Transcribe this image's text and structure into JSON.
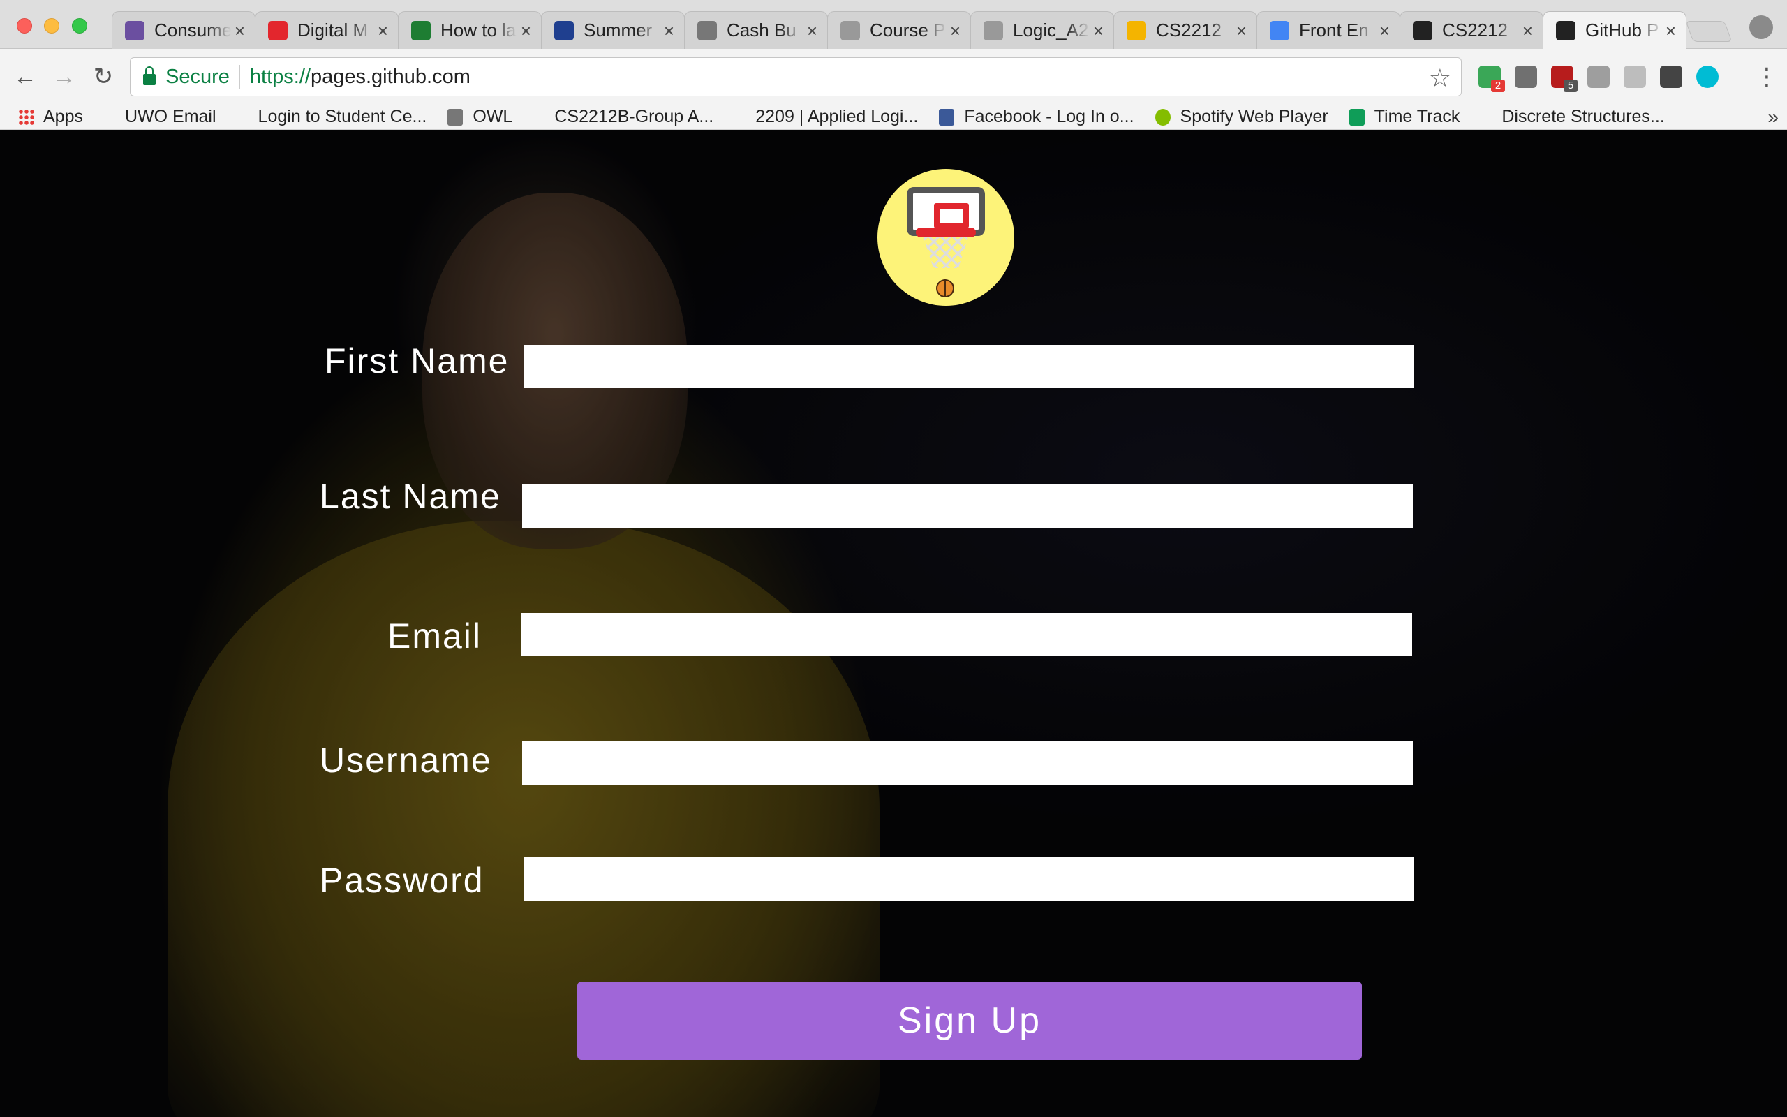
{
  "browser": {
    "tabs": [
      {
        "label": "Consumer",
        "favicon": "shield-icon",
        "color": "#6b4fa0",
        "active": false
      },
      {
        "label": "Digital M",
        "favicon": "red-circle-icon",
        "color": "#e3262d",
        "active": false
      },
      {
        "label": "How to la",
        "favicon": "green-a-icon",
        "color": "#1e7d32",
        "active": false
      },
      {
        "label": "Summer",
        "favicon": "blue-crest-icon",
        "color": "#1f3f8f",
        "active": false
      },
      {
        "label": "Cash Bu",
        "favicon": "mascot-icon",
        "color": "#777777",
        "active": false
      },
      {
        "label": "Course P",
        "favicon": "page-icon",
        "color": "#999999",
        "active": false
      },
      {
        "label": "Logic_A2",
        "favicon": "page-icon",
        "color": "#999999",
        "active": false
      },
      {
        "label": "CS2212",
        "favicon": "google-drive-icon",
        "color": "#f4b400",
        "active": false
      },
      {
        "label": "Front En",
        "favicon": "google-docs-icon",
        "color": "#4285f4",
        "active": false
      },
      {
        "label": "CS2212",
        "favicon": "github-icon",
        "color": "#222222",
        "active": false
      },
      {
        "label": "GitHub P",
        "favicon": "github-icon",
        "color": "#222222",
        "active": true
      }
    ],
    "close_glyph": "×",
    "security_label": "Secure",
    "url_scheme": "https://",
    "url_host": "pages.github.com",
    "extensions": [
      {
        "name": "green-extension-icon",
        "color": "#3aa757",
        "badge": "2",
        "badge_color": "#e53935"
      },
      {
        "name": "google-drive-extension-icon",
        "color": "#707070",
        "badge": "",
        "badge_color": ""
      },
      {
        "name": "ublock-icon",
        "color": "#b71c1c",
        "badge": "5",
        "badge_color": "#555555"
      },
      {
        "name": "power-icon",
        "color": "#9e9e9e",
        "badge": "",
        "badge_color": ""
      },
      {
        "name": "recycle-icon",
        "color": "#bdbdbd",
        "badge": "",
        "badge_color": ""
      },
      {
        "name": "color-wheel-icon",
        "color": "#444444",
        "badge": "",
        "badge_color": ""
      },
      {
        "name": "m-avatar-icon",
        "color": "#00bcd4",
        "badge": "",
        "badge_color": ""
      }
    ],
    "bookmarks": [
      {
        "label": "Apps",
        "icon": "apps-grid-icon"
      },
      {
        "label": "UWO Email",
        "icon": "page-icon"
      },
      {
        "label": "Login to Student Ce...",
        "icon": "page-icon"
      },
      {
        "label": "OWL",
        "icon": "owl-icon"
      },
      {
        "label": "CS2212B-Group A...",
        "icon": "page-icon"
      },
      {
        "label": "2209 | Applied Logi...",
        "icon": "page-icon"
      },
      {
        "label": "Facebook - Log In o...",
        "icon": "facebook-icon"
      },
      {
        "label": "Spotify Web Player",
        "icon": "spotify-icon"
      },
      {
        "label": "Time Track",
        "icon": "sheets-icon"
      },
      {
        "label": "Discrete Structures...",
        "icon": "page-icon"
      }
    ],
    "bookmarks_overflow": "»"
  },
  "form": {
    "logo_icon": "basketball-hoop-icon",
    "fields": {
      "first_name": {
        "label": "First Name",
        "value": ""
      },
      "last_name": {
        "label": "Last Name",
        "value": ""
      },
      "email": {
        "label": "Email",
        "value": ""
      },
      "username": {
        "label": "Username",
        "value": ""
      },
      "password": {
        "label": "Password",
        "value": ""
      }
    },
    "submit_label": "Sign Up",
    "button_color": "#a066d8",
    "logo_color": "#fdf379"
  }
}
